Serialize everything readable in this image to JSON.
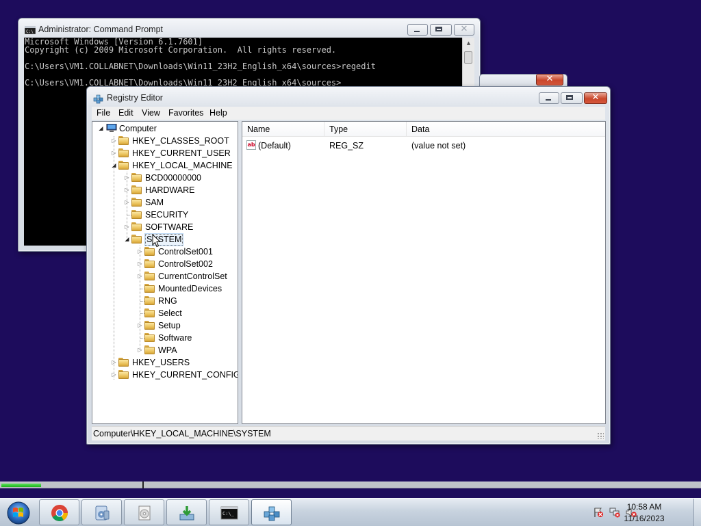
{
  "cmd": {
    "title": "Administrator: Command Prompt",
    "lines": [
      "Microsoft Windows [Version 6.1.7601]",
      "Copyright (c) 2009 Microsoft Corporation.  All rights reserved.",
      "",
      "C:\\Users\\VM1.COLLABNET\\Downloads\\Win11_23H2_English_x64\\sources>regedit",
      "",
      "C:\\Users\\VM1.COLLABNET\\Downloads\\Win11_23H2_English_x64\\sources>"
    ]
  },
  "regedit": {
    "title": "Registry Editor",
    "menu": [
      "File",
      "Edit",
      "View",
      "Favorites",
      "Help"
    ],
    "tree": [
      {
        "label": "Computer",
        "expander": "open"
      },
      {
        "label": "HKEY_CLASSES_ROOT",
        "expander": "closed"
      },
      {
        "label": "HKEY_CURRENT_USER",
        "expander": "closed"
      },
      {
        "label": "HKEY_LOCAL_MACHINE",
        "expander": "open"
      },
      {
        "label": "BCD00000000",
        "expander": "closed"
      },
      {
        "label": "HARDWARE",
        "expander": "closed"
      },
      {
        "label": "SAM",
        "expander": "closed"
      },
      {
        "label": "SECURITY",
        "expander": "none"
      },
      {
        "label": "SOFTWARE",
        "expander": "closed"
      },
      {
        "label": "SYSTEM",
        "expander": "open",
        "selected": true
      },
      {
        "label": "ControlSet001",
        "expander": "closed"
      },
      {
        "label": "ControlSet002",
        "expander": "closed"
      },
      {
        "label": "CurrentControlSet",
        "expander": "closed"
      },
      {
        "label": "MountedDevices",
        "expander": "none"
      },
      {
        "label": "RNG",
        "expander": "none"
      },
      {
        "label": "Select",
        "expander": "none"
      },
      {
        "label": "Setup",
        "expander": "closed"
      },
      {
        "label": "Software",
        "expander": "none"
      },
      {
        "label": "WPA",
        "expander": "closed"
      },
      {
        "label": "HKEY_USERS",
        "expander": "closed"
      },
      {
        "label": "HKEY_CURRENT_CONFIG",
        "expander": "closed"
      }
    ],
    "columns": [
      "Name",
      "Type",
      "Data"
    ],
    "values": [
      {
        "name": "(Default)",
        "type": "REG_SZ",
        "data": "(value not set)"
      }
    ],
    "status": "Computer\\HKEY_LOCAL_MACHINE\\SYSTEM"
  },
  "progress": {
    "fraction": 0.057
  },
  "taskbar": {
    "items": [
      "chrome-icon",
      "media-player-icon",
      "disc-icon",
      "download-installer-icon",
      "command-prompt-icon",
      "regedit-icon"
    ],
    "clock_time": "10:58 AM",
    "clock_date": "11/16/2023"
  }
}
